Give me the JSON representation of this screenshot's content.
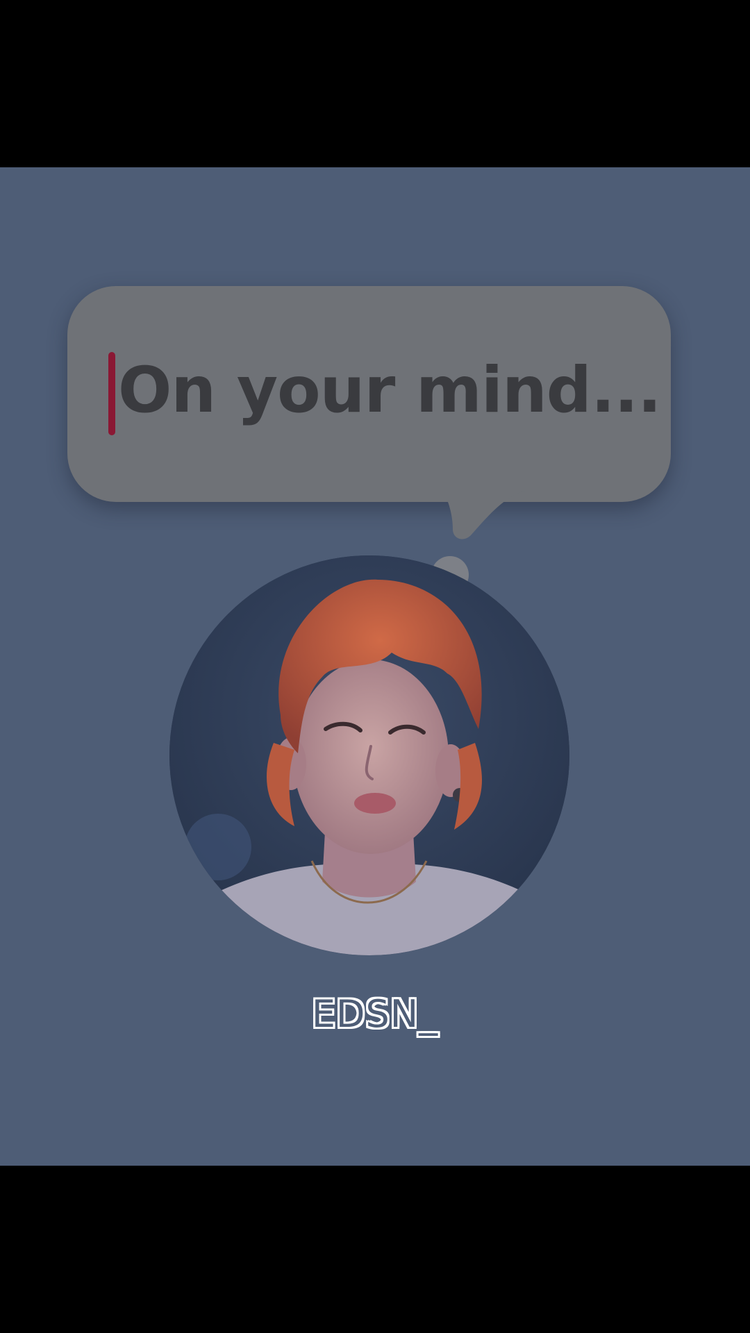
{
  "post": {
    "prompt_text": "On your mind...",
    "username": "EDSN_"
  },
  "avatar": {
    "icon": "profile-photo-icon",
    "description_hidden": true
  },
  "colors": {
    "background": "#4e5d76",
    "letterbox": "#000000",
    "bubble": "#6f7277",
    "bubble_text": "#3a3b3f",
    "caret": "#8a1834",
    "username_outline": "#ffffff"
  }
}
